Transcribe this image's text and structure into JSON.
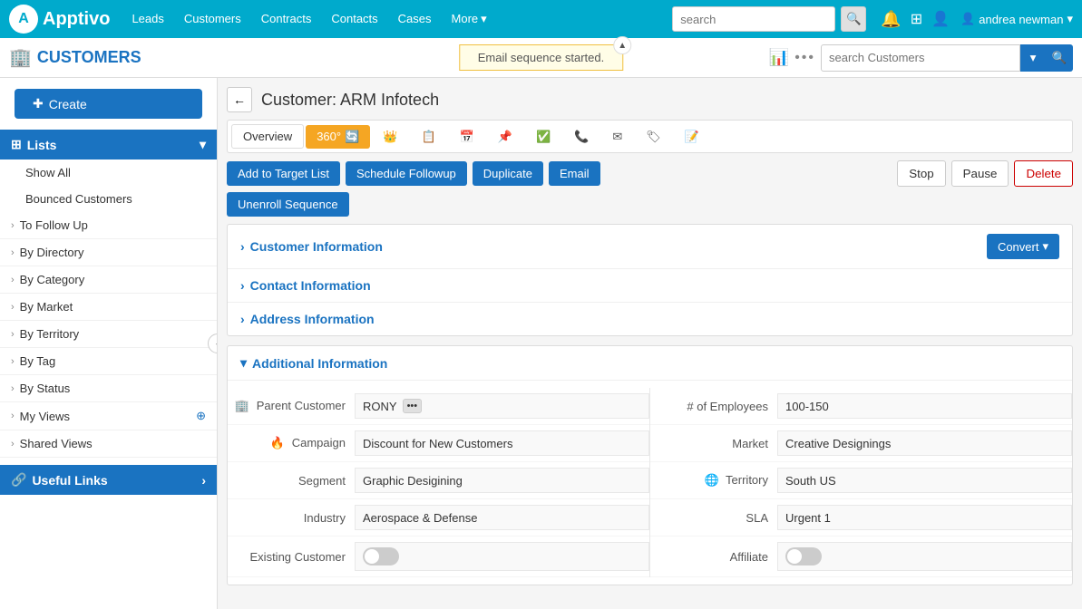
{
  "app": {
    "logo": "Apptivo"
  },
  "top_nav": {
    "items": [
      "Leads",
      "Customers",
      "Contracts",
      "Contacts",
      "Cases",
      "More"
    ],
    "search_placeholder": "search",
    "user": "andrea newman"
  },
  "sub_header": {
    "title": "CUSTOMERS",
    "email_sequence_banner": "Email sequence started.",
    "search_placeholder": "search Customers"
  },
  "sidebar": {
    "create_label": "Create",
    "lists_label": "Lists",
    "sub_items": [
      "Show All",
      "Bounced Customers"
    ],
    "groups": [
      "To Follow Up",
      "By Directory",
      "By Category",
      "By Market",
      "By Territory",
      "By Tag",
      "By Status",
      "My Views",
      "Shared Views"
    ],
    "useful_links_label": "Useful Links"
  },
  "page": {
    "back_label": "←",
    "title": "Customer: ARM Infotech"
  },
  "tabs": [
    {
      "label": "Overview",
      "active": true
    },
    {
      "label": "360°",
      "orange": true
    },
    {
      "label": "👑"
    },
    {
      "label": "📋"
    },
    {
      "label": "📅"
    },
    {
      "label": "📌"
    },
    {
      "label": "✅"
    },
    {
      "label": "📞"
    },
    {
      "label": "✉"
    },
    {
      "label": "🏷"
    },
    {
      "label": "📝"
    }
  ],
  "actions": {
    "add_to_target_list": "Add to Target List",
    "schedule_followup": "Schedule Followup",
    "duplicate": "Duplicate",
    "email": "Email",
    "unenroll_sequence": "Unenroll Sequence",
    "stop": "Stop",
    "pause": "Pause",
    "delete": "Delete",
    "convert": "Convert"
  },
  "sections": [
    {
      "label": "Customer Information",
      "expanded": false
    },
    {
      "label": "Contact Information",
      "expanded": false
    },
    {
      "label": "Address Information",
      "expanded": false
    },
    {
      "label": "Additional Information",
      "expanded": true
    }
  ],
  "additional_info": {
    "left": [
      {
        "label": "Parent Customer",
        "value": "RONY",
        "type": "parent"
      },
      {
        "label": "Campaign",
        "value": "Discount for New Customers"
      },
      {
        "label": "Segment",
        "value": "Graphic Desigining"
      },
      {
        "label": "Industry",
        "value": "Aerospace & Defense"
      },
      {
        "label": "Existing Customer",
        "value": "",
        "type": "toggle"
      }
    ],
    "right": [
      {
        "label": "# of Employees",
        "value": "100-150"
      },
      {
        "label": "Market",
        "value": "Creative Designings"
      },
      {
        "label": "Territory",
        "value": "South US",
        "icon": "globe"
      },
      {
        "label": "SLA",
        "value": "Urgent 1"
      },
      {
        "label": "Affiliate",
        "value": "",
        "type": "toggle"
      }
    ]
  }
}
